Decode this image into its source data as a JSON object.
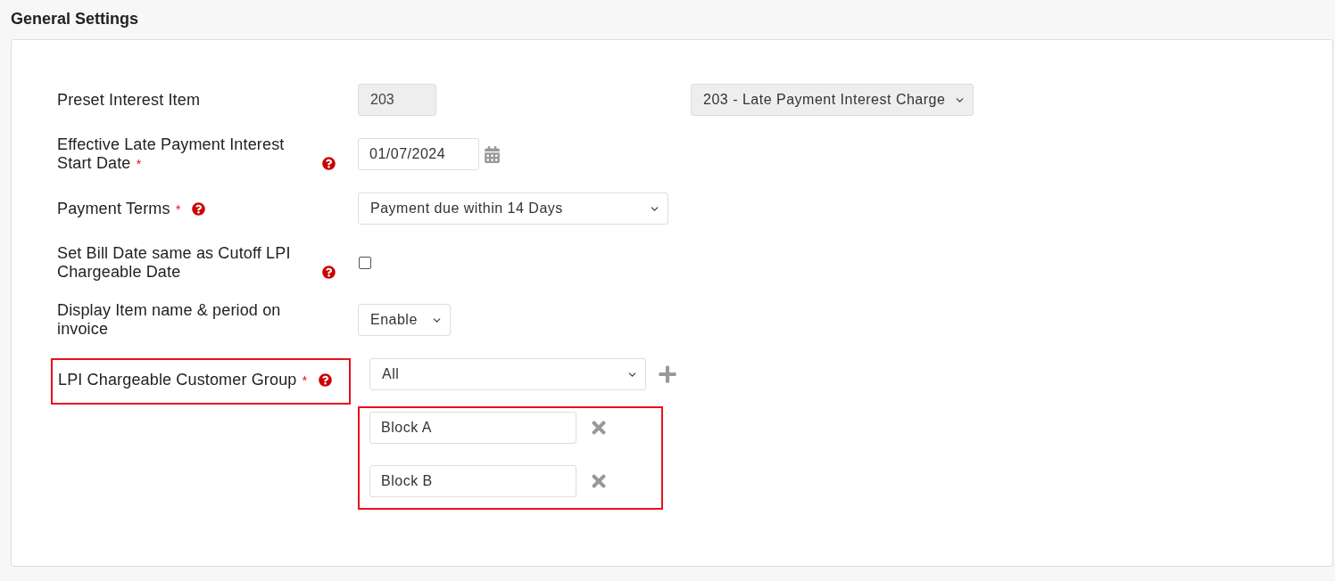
{
  "title": "General Settings",
  "rows": [
    {
      "kind": "preset",
      "label": "Preset Interest Item",
      "help": false,
      "highlighted": false,
      "code": "203",
      "value": "203 - Late Payment Interest Charge"
    },
    {
      "kind": "date",
      "label": "Effective Late Payment Interest Start Date",
      "marker": "*",
      "help": true,
      "highlighted": false,
      "value": "01/07/2024"
    },
    {
      "kind": "select",
      "label": "Payment Terms",
      "marker": "*",
      "help": true,
      "highlighted": false,
      "value": "Payment due within 14 Days"
    },
    {
      "kind": "checkbox",
      "label": "Set Bill Date same as Cutoff LPI Chargeable Date",
      "help": true,
      "highlighted": false,
      "checked": false
    },
    {
      "kind": "toggle",
      "label": "Display Item name & period on invoice",
      "help": false,
      "highlighted": false,
      "value": "Enable"
    },
    {
      "kind": "group",
      "label": "LPI Chargeable Customer Group",
      "marker": "*",
      "help": true,
      "highlighted": true,
      "value": "All",
      "entries_highlighted": true,
      "entries": [
        {
          "value": "Block A"
        },
        {
          "value": "Block B"
        }
      ]
    }
  ]
}
